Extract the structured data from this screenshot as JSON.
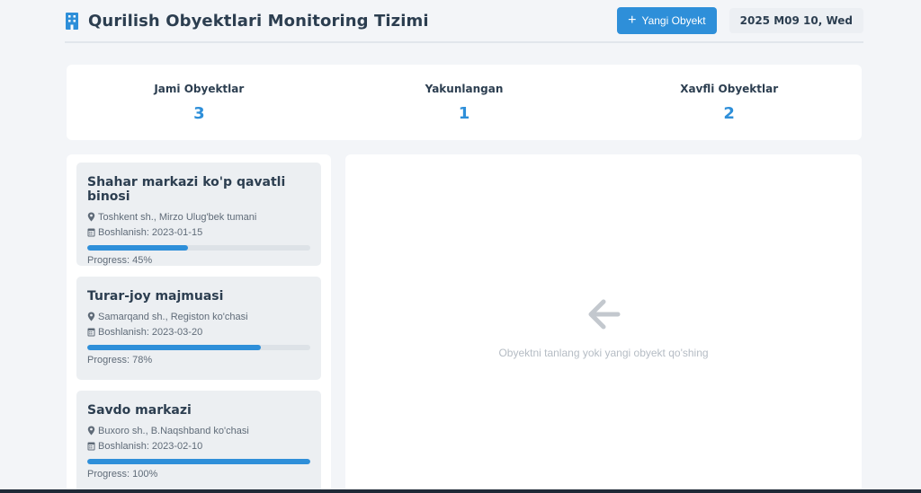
{
  "header": {
    "title": "Qurilish Obyektlari Monitoring Tizimi",
    "title_icon": "building-icon",
    "add_button_label": "Yangi Obyekt",
    "date": "2025 M09 10, Wed"
  },
  "stats": [
    {
      "label": "Jami Obyektlar",
      "value": "3"
    },
    {
      "label": "Yakunlangan",
      "value": "1"
    },
    {
      "label": "Xavfli Obyektlar",
      "value": "2"
    }
  ],
  "projects": [
    {
      "name": "Shahar markazi ko'p qavatli binosi",
      "location": "Toshkent sh., Mirzo Ulug'bek tumani",
      "start": "Boshlanish: 2023-01-15",
      "progress_value": 45,
      "progress_text": "Progress: 45%"
    },
    {
      "name": "Turar-joy majmuasi",
      "location": "Samarqand sh., Registon ko'chasi",
      "start": "Boshlanish: 2023-03-20",
      "progress_value": 78,
      "progress_text": "Progress: 78%"
    },
    {
      "name": "Savdo markazi",
      "location": "Buxoro sh., B.Naqshband ko'chasi",
      "start": "Boshlanish: 2023-02-10",
      "progress_value": 100,
      "progress_text": "Progress: 100%"
    }
  ],
  "detail": {
    "empty_text": "Obyektni tanlang yoki yangi obyekt qo'shing",
    "empty_icon": "arrow-left-icon"
  },
  "colors": {
    "accent": "#2e8fd9",
    "background": "#f3f5f8",
    "text": "#2c3e50"
  }
}
